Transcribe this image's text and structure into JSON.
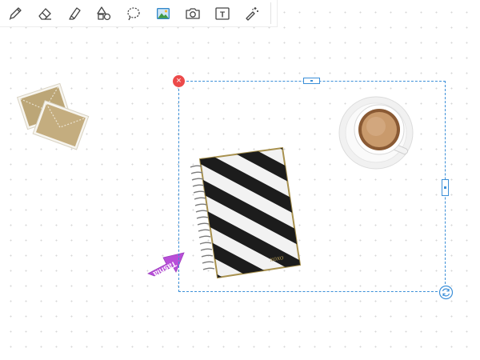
{
  "toolbar": {
    "tools": [
      {
        "name": "pen",
        "icon": "pen-icon"
      },
      {
        "name": "eraser",
        "icon": "eraser-icon"
      },
      {
        "name": "highlighter",
        "icon": "highlighter-icon"
      },
      {
        "name": "shapes",
        "icon": "shapes-icon"
      },
      {
        "name": "lasso",
        "icon": "lasso-icon"
      },
      {
        "name": "image",
        "icon": "image-icon"
      },
      {
        "name": "camera",
        "icon": "camera-icon"
      },
      {
        "name": "text",
        "icon": "text-box-icon",
        "glyph": "T"
      },
      {
        "name": "sticker",
        "icon": "magic-wand-icon"
      }
    ]
  },
  "canvas": {
    "background": "dot-grid",
    "objects": [
      {
        "type": "image",
        "name": "envelopes"
      },
      {
        "type": "image",
        "name": "coffee-cup"
      },
      {
        "type": "image",
        "name": "striped-notebook",
        "handwriting": "xoxo"
      },
      {
        "type": "sticker",
        "name": "purple-arrow",
        "label": "Tasnia"
      }
    ]
  },
  "selection": {
    "delete_glyph": "×"
  },
  "colors": {
    "accent": "#3b8fd8",
    "delete": "#ec4a4a",
    "icon_stroke": "#444444",
    "image_icon": "#2f86c9",
    "sticker": "#b84fd8"
  }
}
